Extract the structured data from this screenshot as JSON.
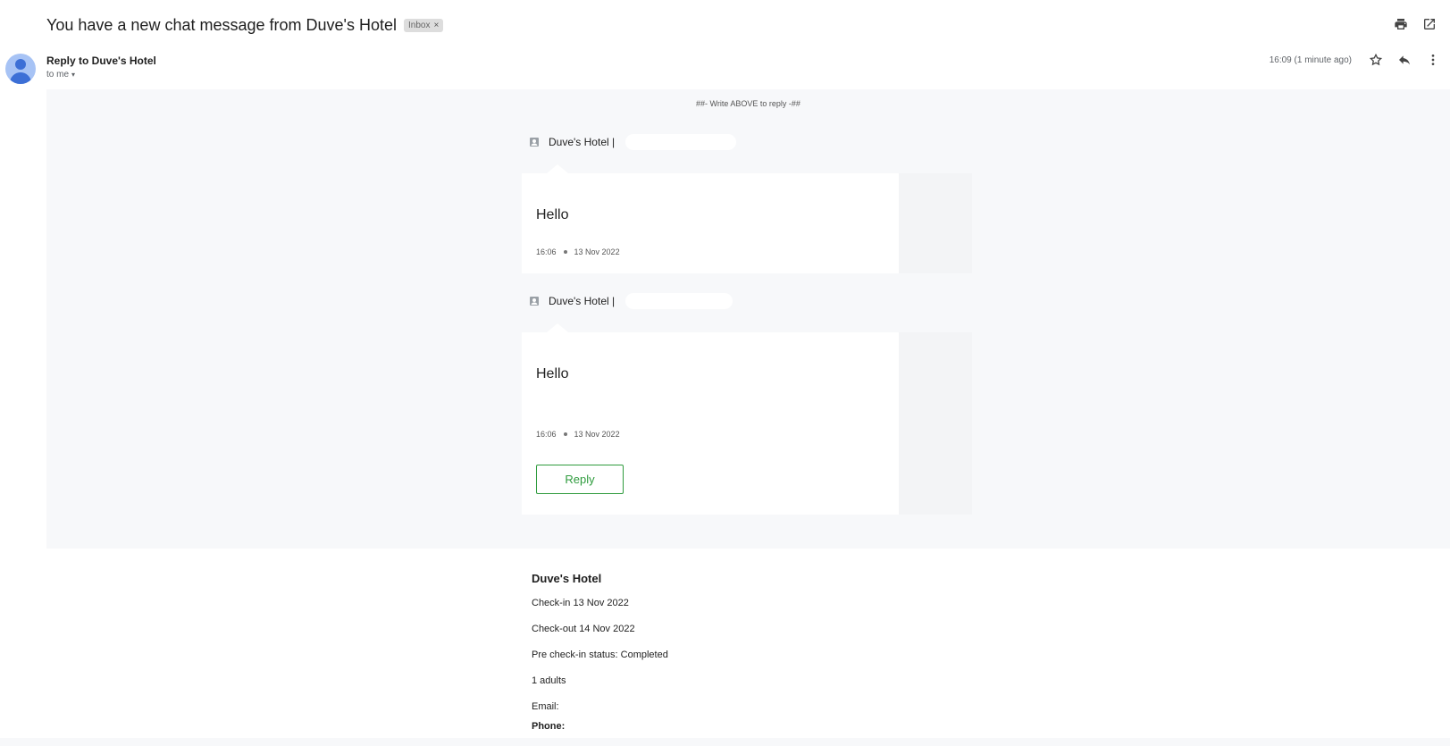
{
  "email": {
    "subject": "You have a new chat message from Duve's Hotel",
    "label_chip": "Inbox",
    "label_chip_close": "×",
    "sender": "Reply to Duve's Hotel",
    "recipient": "to me",
    "timestamp": "16:09 (1 minute ago)"
  },
  "icons": {
    "print": "print-icon",
    "open_new": "open-in-new-icon",
    "star": "star-icon",
    "reply": "reply-icon",
    "more": "more-vert-icon",
    "contact": "contact-card-icon",
    "avatar": "person-icon"
  },
  "body": {
    "reply_hint": "##- Write ABOVE to reply -##",
    "messages": [
      {
        "sender": "Duve's Hotel |",
        "text": "Hello",
        "time": "16:06",
        "date": "13 Nov 2022"
      },
      {
        "sender": "Duve's Hotel |",
        "text": "Hello",
        "time": "16:06",
        "date": "13 Nov 2022",
        "reply_label": "Reply"
      }
    ]
  },
  "reservation": {
    "hotel": "Duve's Hotel",
    "check_in": "Check-in 13 Nov 2022",
    "check_out": "Check-out 14 Nov 2022",
    "pre_checkin": "Pre check-in status: Completed",
    "guests": "1 adults",
    "email_label": "Email:",
    "phone_label": "Phone:"
  },
  "colors": {
    "accent_green": "#2e9b3d",
    "band_gray": "#f7f8fa",
    "avatar_blue": "#3c6fd6"
  }
}
